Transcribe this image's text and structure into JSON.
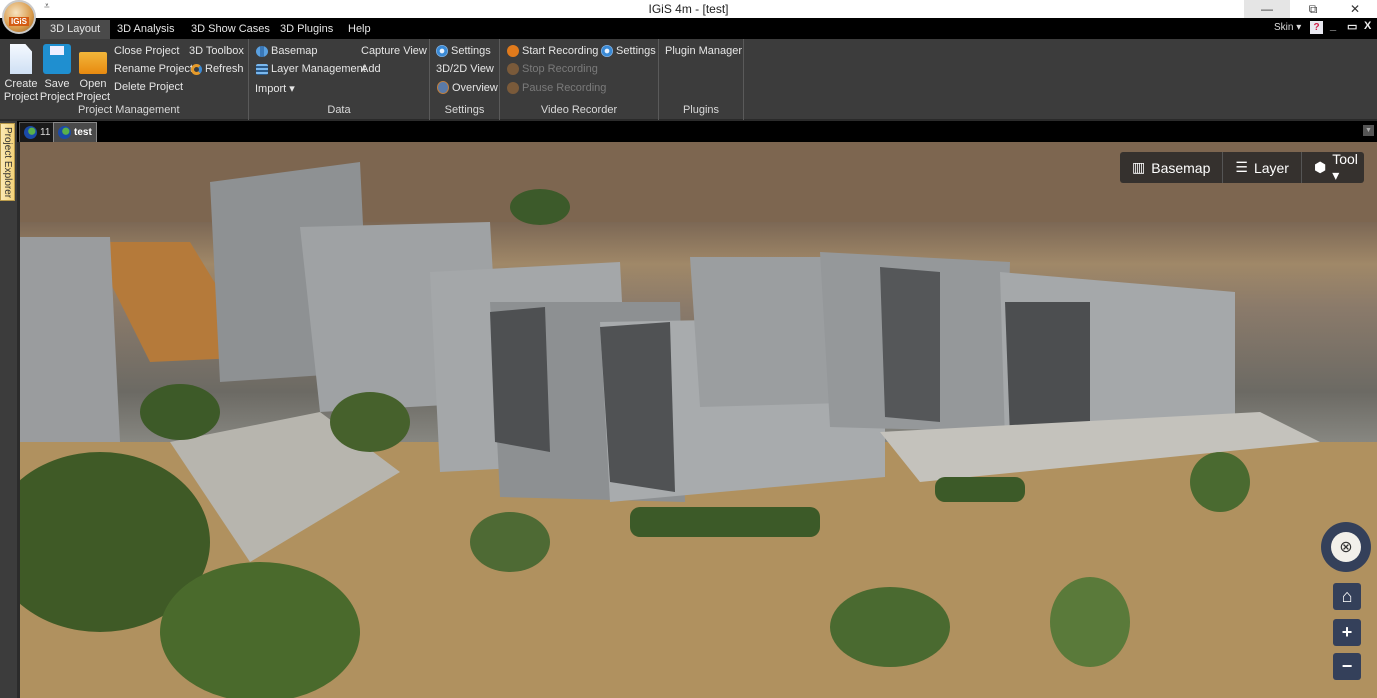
{
  "window": {
    "title": "IGiS 4m - [test]",
    "logo_text": "IGiS",
    "quick_access": "⩡",
    "controls": {
      "minimize": "—",
      "maximize": "⧉",
      "close": "✕"
    }
  },
  "ribbon_tabs": [
    {
      "label": "3D Layout",
      "active": true
    },
    {
      "label": "3D Analysis",
      "active": false
    },
    {
      "label": "3D Show Cases",
      "active": false
    },
    {
      "label": "3D Plugins",
      "active": false
    },
    {
      "label": "Help",
      "active": false
    }
  ],
  "topright": {
    "skin_label": "Skin ▾",
    "help": "?",
    "mdi_min": "_",
    "mdi_restore": "▭",
    "mdi_close": "X"
  },
  "ribbon": {
    "project_management": {
      "label": "Project Management",
      "create": "Create Project",
      "create_l1": "Create",
      "create_l2": "Project",
      "save_l1": "Save",
      "save_l2": "Project",
      "open_l1": "Open",
      "open_l2": "Project",
      "close": "Close Project",
      "rename": "Rename Project",
      "delete": "Delete Project",
      "toolbox": "3D Toolbox",
      "refresh": "Refresh"
    },
    "data": {
      "label": "Data",
      "basemap": "Basemap",
      "layer_management": "Layer Management",
      "import": "Import ▾",
      "capture_view": "Capture View",
      "add": "Add"
    },
    "settings": {
      "label": "Settings",
      "settings": "Settings",
      "view_toggle": "3D/2D View",
      "overview": "Overview"
    },
    "video_recorder": {
      "label": "Video Recorder",
      "start": "Start Recording",
      "stop": "Stop Recording",
      "pause": "Pause Recording",
      "settings": "Settings"
    },
    "plugins": {
      "label": "Plugins",
      "manager": "Plugin Manager"
    }
  },
  "doc_tabs": [
    {
      "label": "11",
      "active": false
    },
    {
      "label": "test",
      "active": true
    }
  ],
  "side_panel": {
    "label": "Project Explorer"
  },
  "map_toolbar": {
    "basemap": "Basemap",
    "layer": "Layer",
    "tool": "Tool ▾"
  },
  "nav_controls": {
    "compass": "⊗",
    "home": "⌂",
    "zoom_in": "+",
    "zoom_out": "−"
  },
  "colors": {
    "ribbon_bg": "#3c3c3c",
    "tab_strip_bg": "#000000",
    "active_tab_bg": "#4a4a4a",
    "nav_btn_bg": "#34405a",
    "recorder_orange": "#e07a1c"
  }
}
